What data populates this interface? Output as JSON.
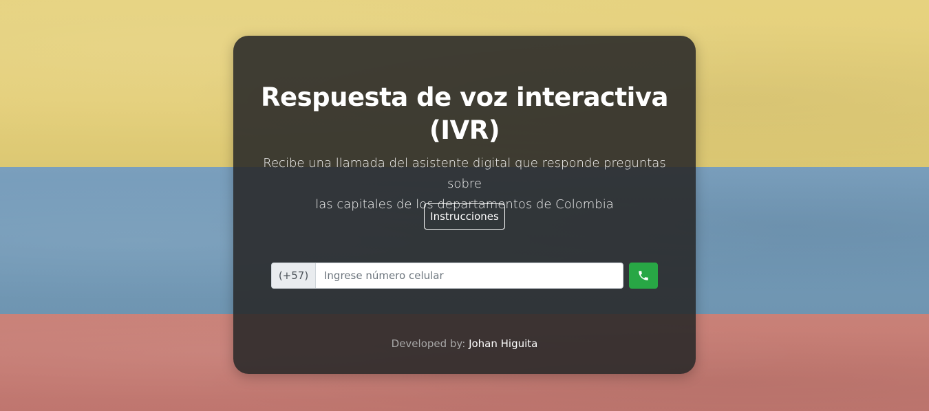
{
  "background": {
    "colors": [
      "#e4cf7a",
      "#7299b7",
      "#c47a72"
    ]
  },
  "card": {
    "title_line1": "Respuesta de voz interactiva",
    "title_line2": "(IVR)",
    "subtitle_line1": "Recibe una llamada del asistente digital que responde preguntas sobre",
    "subtitle_line2": "las capitales de los departamentos de Colombia",
    "instructions_button": "Instrucciones",
    "phone": {
      "prefix": "(+57)",
      "placeholder": "Ingrese número celular",
      "value": "",
      "call_icon": "phone-icon",
      "call_button_color": "#28a745"
    },
    "footer": {
      "label": "Developed by:",
      "author": "Johan Higuita"
    }
  }
}
